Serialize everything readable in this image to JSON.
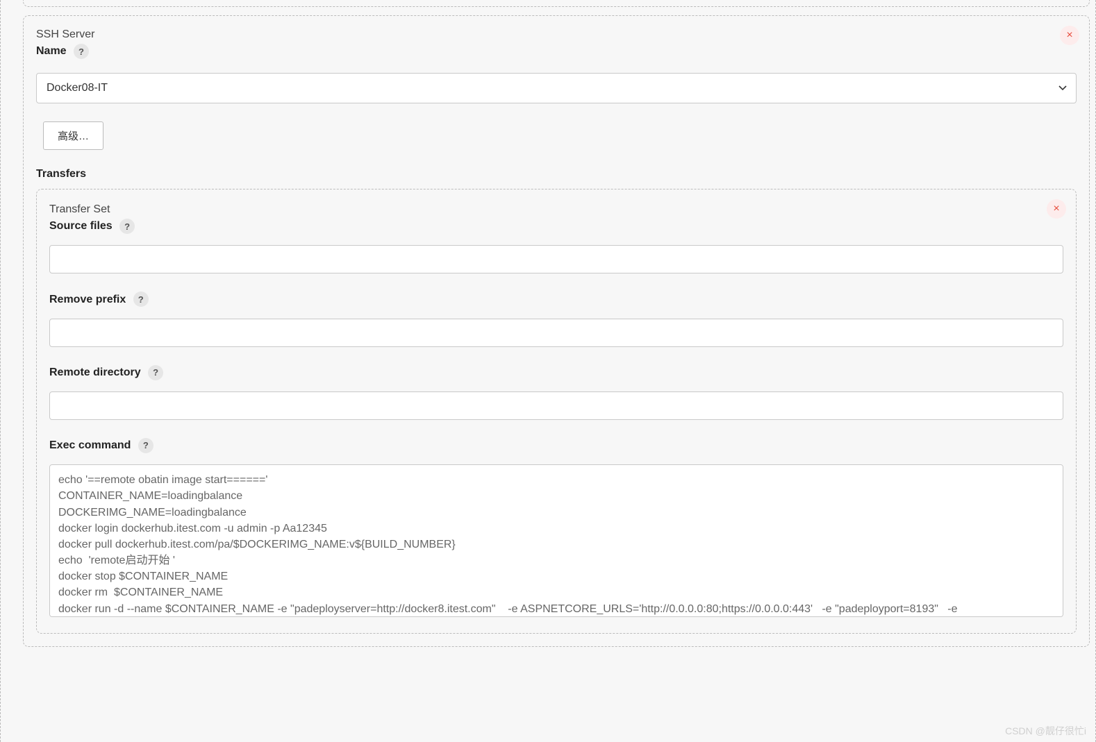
{
  "ssh_server": {
    "title": "SSH Server",
    "name_label": "Name",
    "selected": "Docker08-IT",
    "advanced_button": "高级…",
    "close_icon_glyph": "×"
  },
  "transfers": {
    "heading": "Transfers",
    "set_title": "Transfer Set",
    "close_icon_glyph": "×",
    "source_files": {
      "label": "Source files",
      "value": ""
    },
    "remove_prefix": {
      "label": "Remove prefix",
      "value": ""
    },
    "remote_directory": {
      "label": "Remote directory",
      "value": ""
    },
    "exec_command": {
      "label": "Exec command",
      "value": "echo '==remote obatin image start======'\nCONTAINER_NAME=loadingbalance\nDOCKERIMG_NAME=loadingbalance\ndocker login dockerhub.itest.com -u admin -p Aa12345\ndocker pull dockerhub.itest.com/pa/$DOCKERIMG_NAME:v${BUILD_NUMBER}\necho  'remote启动开始 '\ndocker stop $CONTAINER_NAME\ndocker rm  $CONTAINER_NAME\ndocker run -d --name $CONTAINER_NAME -e \"padeployserver=http://docker8.itest.com\"    -e ASPNETCORE_URLS='http://0.0.0.0:80;https://0.0.0.0:443'   -e \"padeployport=8193\"   -e ASPNETCORE_Kestrel__Certificates__Default__Path='/app/server.pfx'   -e ASPNETCORE_Kestrel__Certificates__Default__Password='wyzhd'  -p"
    },
    "help_glyph": "?"
  },
  "watermark": "CSDN @靓仔很忙i"
}
